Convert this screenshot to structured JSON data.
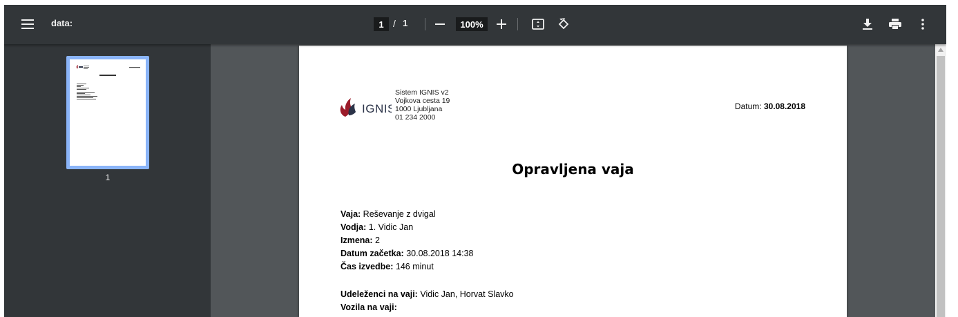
{
  "toolbar": {
    "title": "data:",
    "page_current": "1",
    "page_separator": "/",
    "page_total": "1",
    "zoom": "100%",
    "icons": {
      "menu": "hamburger-menu-icon",
      "zoom_out": "minus-icon",
      "zoom_in": "plus-icon",
      "fit": "fit-to-page-icon",
      "rotate": "rotate-icon",
      "download": "download-icon",
      "print": "print-icon",
      "more": "more-vert-icon"
    }
  },
  "sidebar": {
    "thumbnail_page_number": "1"
  },
  "document": {
    "logo_text": "IGNIS",
    "company_lines": [
      "Sistem IGNIS v2",
      "Vojkova cesta 19",
      "1000 Ljubljana",
      "01 234 2000"
    ],
    "date_label": "Datum:",
    "date_value": "30.08.2018",
    "heading": "Opravljena vaja",
    "fields": [
      {
        "label": "Vaja:",
        "value": "Reševanje z dvigal"
      },
      {
        "label": "Vodja:",
        "value": "1. Vidic Jan"
      },
      {
        "label": "Izmena:",
        "value": "2"
      },
      {
        "label": "Datum začetka:",
        "value": "30.08.2018 14:38"
      },
      {
        "label": "Čas izvedbe:",
        "value": "146 minut"
      }
    ],
    "fields2": [
      {
        "label": "Udeleženci na vaji:",
        "value": "Vidic Jan, Horvat Slavko"
      },
      {
        "label": "Vozila na vaji:",
        "value": ""
      }
    ]
  },
  "colors": {
    "toolbar_bg": "#323639",
    "viewer_bg": "#525659",
    "thumb_highlight": "#8ab4f8",
    "logo_red": "#9b1b2a",
    "logo_navy": "#2b3348"
  }
}
